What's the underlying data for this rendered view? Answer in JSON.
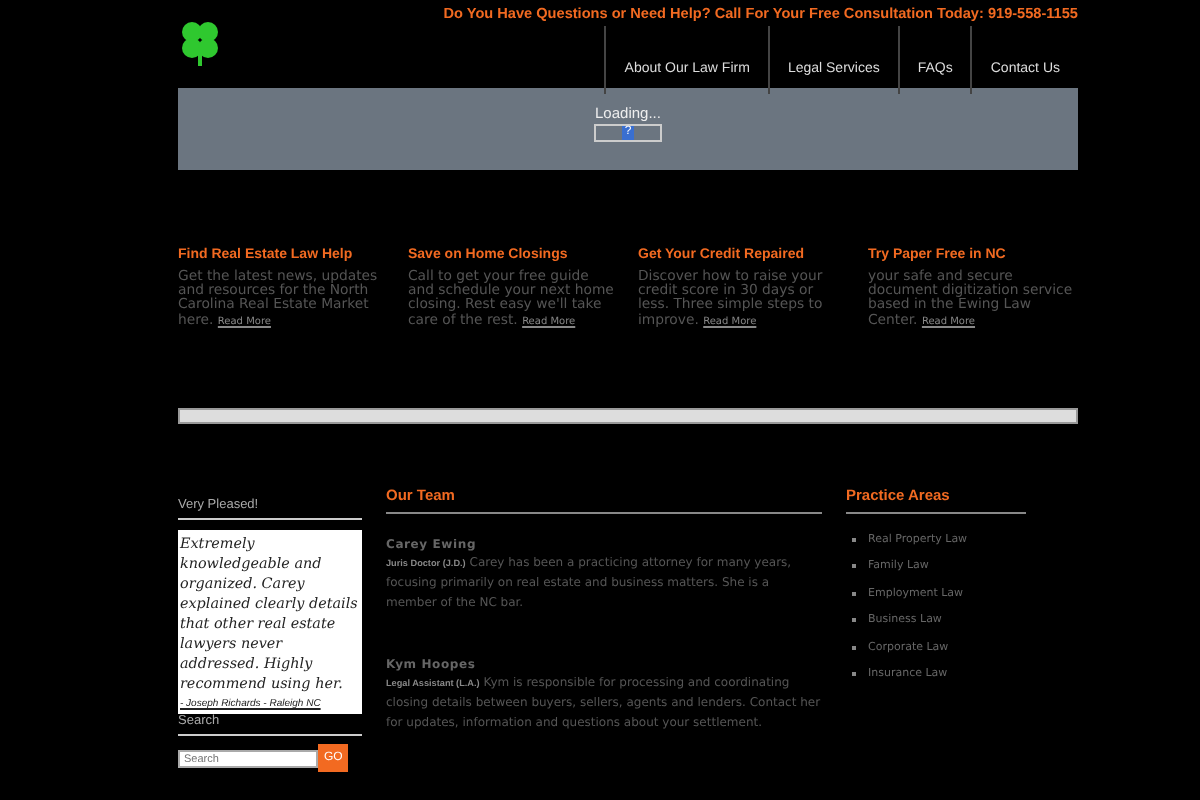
{
  "header": {
    "tagline": "Do You Have Questions or Need Help? Call For Your Free Consultation Today: 919-558-1155",
    "nav": [
      {
        "label": "About Our Law Firm"
      },
      {
        "label": "Legal Services"
      },
      {
        "label": "FAQs"
      },
      {
        "label": "Contact Us"
      }
    ]
  },
  "banner": {
    "loading": "Loading...",
    "button": "?"
  },
  "features": [
    {
      "title": "Find Real Estate Law Help",
      "text": "Get the latest news, updates and resources for the North Carolina Real Estate Market here.",
      "link": "Read More"
    },
    {
      "title": "Save on Home Closings",
      "text": "Call to get your free guide and schedule your next home closing. Rest easy we'll take care of the rest.",
      "link": "Read More"
    },
    {
      "title": "Get Your Credit Repaired",
      "text": "Discover how to raise your credit score in 30 days or less. Three simple steps to improve.",
      "link": "Read More"
    },
    {
      "title": "Try Paper Free in NC",
      "text": "your safe and secure document digitization service based in the Ewing Law Center.",
      "link": "Read More"
    }
  ],
  "testimonial": {
    "title": "Very Pleased!",
    "quote": "Extremely knowledgeable and organized. Carey explained clearly details that other real estate lawyers never addressed. Highly recommend using her.",
    "author": "- Joseph Richards - Raleigh NC"
  },
  "search": {
    "title": "Search",
    "placeholder": "Search",
    "button": "GO"
  },
  "team": {
    "title": "Our Team",
    "members": [
      {
        "name": "Carey Ewing",
        "role": "Juris Doctor (J.D.)",
        "bio": "Carey has been a practicing attorney for many years, focusing primarily on real estate and business matters. She is a member of the NC bar."
      },
      {
        "name": "Kym Hoopes",
        "role": "Legal Assistant (L.A.)",
        "bio": "Kym is responsible for processing and coordinating closing details between buyers, sellers, agents and lenders. Contact her for updates, information and questions about your settlement."
      }
    ]
  },
  "practice": {
    "title": "Practice Areas",
    "items": [
      "Real Property Law",
      "Family Law",
      "Employment Law",
      "Business Law",
      "Corporate Law",
      "Insurance Law"
    ]
  }
}
